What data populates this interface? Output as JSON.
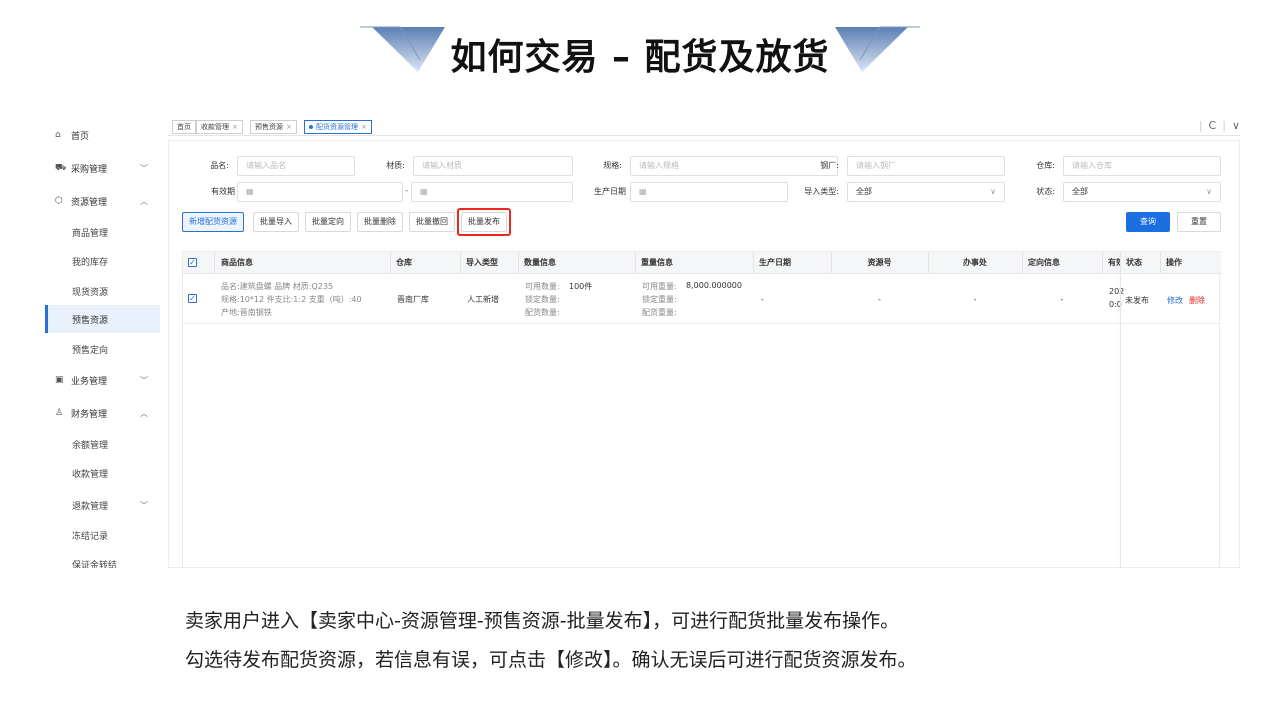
{
  "slide": {
    "title": "如何交易 – 配货及放货",
    "caption_line1": "卖家用户进入【卖家中心-资源管理-预售资源-批量发布】，可进行配货批量发布操作。",
    "caption_line2": "勾选待发布配货资源，若信息有误，可点击【修改】。确认无误后可进行配货资源发布。"
  },
  "colors": {
    "accent": "#2a6fd6",
    "highlight": "#e8281e",
    "primary_button": "#1b6fe0"
  },
  "sidebar": {
    "home": "首页",
    "purchase": "采购管理",
    "resource": "资源管理",
    "resource_items": [
      "商品管理",
      "我的库存",
      "现货资源",
      "预售资源",
      "预售定向"
    ],
    "business": "业务管理",
    "finance": "财务管理",
    "finance_items": [
      "余额管理",
      "收款管理",
      "退款管理",
      "冻结记录",
      "保证金转结"
    ]
  },
  "tabs": [
    "首页",
    "收款管理",
    "预售资源",
    "配货资源管理"
  ],
  "filters": {
    "name_label": "品名:",
    "name_placeholder": "请输入品名",
    "material_label": "材质:",
    "material_placeholder": "请输入材质",
    "spec_label": "规格:",
    "spec_placeholder": "请输入规格",
    "mill_label": "钢厂:",
    "mill_placeholder": "请输入钢厂",
    "warehouse_label": "仓库:",
    "warehouse_placeholder": "请输入仓库",
    "validity_label": "有效期",
    "range_sep": "-",
    "prod_date_label": "生产日期",
    "import_type_label": "导入类型:",
    "import_type_value": "全部",
    "status_label": "状态:",
    "status_value": "全部"
  },
  "toolbar": {
    "add": "新增配货资源",
    "batch_import": "批量导入",
    "batch_direct": "批量定向",
    "batch_delete": "批量删除",
    "batch_withdraw": "批量撤回",
    "batch_publish": "批量发布",
    "query": "查询",
    "reset": "重置"
  },
  "table": {
    "headers": [
      "商品信息",
      "仓库",
      "导入类型",
      "数量信息",
      "重量信息",
      "生产日期",
      "资源号",
      "办事处",
      "定向信息",
      "有效",
      "状态",
      "操作"
    ],
    "row": {
      "name_line": "品名:建筑盘螺  品牌  材质:Q235",
      "spec_line": "规格:10*12  件支比:1:2  支重（吨）:40",
      "origin_line": "产地:晋南钢铁",
      "warehouse": "晋南厂库",
      "import_type": "人工新增",
      "avail_qty_label": "可用数量:",
      "avail_qty_value": "100件",
      "lock_qty_label": "锁定数量:",
      "alloc_qty_label": "配货数量:",
      "avail_wt_label": "可用重量:",
      "avail_wt_value": "8,000.000000",
      "lock_wt_label": "锁定重量:",
      "alloc_wt_label": "配货重量:",
      "prod_date": "-",
      "resource_no": "-",
      "office": "-",
      "direct_info": "-",
      "valid_line1": "202",
      "valid_line2": "0:0",
      "status": "未发布",
      "edit": "修改",
      "delete": "删除"
    }
  }
}
